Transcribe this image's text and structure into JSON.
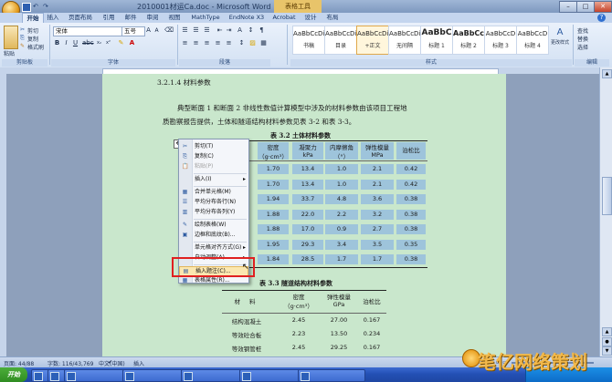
{
  "window": {
    "title": "2010001材运Ca.doc - Microsoft Word",
    "context_tab": "表格工具",
    "controls": [
      "–",
      "□",
      "✕"
    ]
  },
  "tabs": [
    "开始",
    "插入",
    "页面布局",
    "引用",
    "邮件",
    "审阅",
    "视图",
    "MathType",
    "EndNote X3",
    "Acrobat",
    "设计",
    "布局"
  ],
  "ribbon": {
    "clipboard": {
      "paste": "粘贴",
      "cut": "剪切",
      "copy": "复制",
      "format_painter": "格式刷",
      "label": "剪贴板"
    },
    "font": {
      "name": "宋体",
      "size": "五号",
      "label": "字体"
    },
    "paragraph": {
      "label": "段落"
    },
    "styles": {
      "items": [
        {
          "preview": "AaBbCcDi",
          "name": "书稿"
        },
        {
          "preview": "AaBbCcDi",
          "name": "目录"
        },
        {
          "preview": "AaBbCcDi",
          "name": "+正文"
        },
        {
          "preview": "AaBbCcDi",
          "name": "无间隔"
        },
        {
          "preview": "AaBbC",
          "name": "标题 1"
        },
        {
          "preview": "AaBbCc",
          "name": "标题 2"
        },
        {
          "preview": "AaBbCcD",
          "name": "标题 3"
        },
        {
          "preview": "AaBbCcD",
          "name": "标题 4"
        }
      ],
      "change_styles": "更改样式",
      "label": "样式"
    },
    "editing": {
      "find": "查找",
      "replace": "替换",
      "select": "选择",
      "label": "编辑"
    }
  },
  "document": {
    "section_heading": "3.2.1.4 材料参数",
    "para_line1": "典型断面 1 和断面 2 非线性数值计算模型中涉及的材料参数由该项目工程地",
    "para_line2": "质勘察报告提供，土体和隧道结构材料参数见表 3-2 和表 3-3。",
    "table1": {
      "caption": "表 3.2   土体材料参数",
      "headers": [
        [
          "密度",
          "（g·cm³）"
        ],
        [
          "凝聚力",
          "kPa"
        ],
        [
          "内摩擦角",
          "（°）"
        ],
        [
          "弹性模量",
          "MPa"
        ],
        [
          "泊松比"
        ]
      ],
      "rows": [
        [
          "1.70",
          "13.4",
          "1.0",
          "2.1",
          "0.42"
        ],
        [
          "1.70",
          "13.4",
          "1.0",
          "2.1",
          "0.42"
        ],
        [
          "1.94",
          "33.7",
          "4.8",
          "3.6",
          "0.38"
        ],
        [
          "1.88",
          "22.0",
          "2.2",
          "3.2",
          "0.38"
        ],
        [
          "1.88",
          "17.0",
          "0.9",
          "2.7",
          "0.38"
        ],
        [
          "1.95",
          "29.3",
          "3.4",
          "3.5",
          "0.35"
        ],
        [
          "1.84",
          "28.5",
          "1.7",
          "1.7",
          "0.38"
        ]
      ]
    },
    "table2": {
      "caption": "表 3.3   隧道结构材料参数",
      "headers": [
        [
          "材",
          "料"
        ],
        [
          "密度",
          "（g·cm³）"
        ],
        [
          "弹性模量",
          "GPa"
        ],
        [
          "泊松比"
        ]
      ],
      "rows": [
        [
          "结构混凝土",
          "2.45",
          "27.00",
          "0.167"
        ],
        [
          "等效砼合板",
          "2.23",
          "13.50",
          "0.234"
        ],
        [
          "等效钢管桩",
          "2.45",
          "29.25",
          "0.167"
        ]
      ]
    }
  },
  "context_menu": {
    "items": [
      {
        "label": "剪切(T)",
        "icon": "✂",
        "disabled": false,
        "submenu": false
      },
      {
        "label": "复制(C)",
        "icon": "⎘",
        "disabled": false,
        "submenu": false
      },
      {
        "label": "粘贴(P)",
        "icon": "📋",
        "disabled": true,
        "submenu": false
      },
      {
        "label": "插入(I)",
        "icon": "",
        "disabled": false,
        "submenu": true
      },
      {
        "label": "合并单元格(M)",
        "icon": "▦",
        "disabled": false,
        "submenu": false
      },
      {
        "label": "平均分布各行(N)",
        "icon": "☰",
        "disabled": false,
        "submenu": false
      },
      {
        "label": "平均分布各列(Y)",
        "icon": "▥",
        "disabled": false,
        "submenu": false
      },
      {
        "label": "绘制表格(W)",
        "icon": "✎",
        "disabled": false,
        "submenu": false
      },
      {
        "label": "边框和底纹(B)...",
        "icon": "▣",
        "disabled": false,
        "submenu": false
      },
      {
        "label": "单元格对齐方式(G)",
        "icon": "",
        "disabled": false,
        "submenu": true
      },
      {
        "label": "自动调整(A)",
        "icon": "",
        "disabled": false,
        "submenu": true
      },
      {
        "label": "插入题注(C)...",
        "icon": "▤",
        "disabled": false,
        "submenu": false,
        "highlighted": true
      },
      {
        "label": "表格属性(R)...",
        "icon": "▦",
        "disabled": false,
        "submenu": false
      }
    ]
  },
  "status_bar": {
    "page": "页面: 44/88",
    "words": "字数: 116/43,769",
    "lang": "中文(中国)",
    "mode": "插入"
  },
  "taskbar": {
    "start": "开始",
    "tasks": [
      "",
      "",
      "",
      "",
      "",
      "",
      ""
    ]
  },
  "watermark": "笔亿网络策划"
}
